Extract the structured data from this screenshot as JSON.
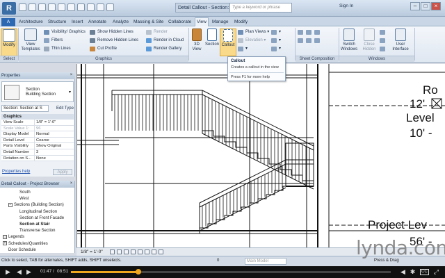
{
  "window": {
    "title": "Detail Callout - Section: Section at Stair",
    "search_placeholder": "Type a keyword or phrase",
    "sign_in": "Sign In"
  },
  "ribbon_tabs": [
    {
      "label": "A"
    },
    {
      "label": "Architecture"
    },
    {
      "label": "Structure"
    },
    {
      "label": "Insert"
    },
    {
      "label": "Annotate"
    },
    {
      "label": "Analyze"
    },
    {
      "label": "Massing & Site"
    },
    {
      "label": "Collaborate"
    },
    {
      "label": "View"
    },
    {
      "label": "Manage"
    },
    {
      "label": "Modify"
    }
  ],
  "ribbon": {
    "select_panel": "Select",
    "graphics_panel": "Graphics",
    "create_panel": "Create",
    "sheet_panel": "Sheet Composition",
    "windows_panel": "Windows",
    "modify_label": "Modify",
    "view_templates_label": "View Templates",
    "visibility_graphics": "Visibility/ Graphics",
    "filters": "Filters",
    "thin_lines": "Thin Lines",
    "show_hidden_lines": "Show Hidden Lines",
    "remove_hidden_lines": "Remove Hidden Lines",
    "cut_profile": "Cut Profile",
    "render": "Render",
    "render_in_cloud": "Render in Cloud",
    "render_gallery": "Render Gallery",
    "view_3d_label": "3D View",
    "section_label": "Section",
    "callout_label": "Callout",
    "plan_views": "Plan Views",
    "elevation": "Elevation",
    "switch_windows": "Switch Windows",
    "close_hidden": "Close Hidden",
    "user_interface": "User Interface"
  },
  "tooltip": {
    "title": "Callout",
    "description": "Creates a callout in the view",
    "help": "Press F1 for more help"
  },
  "properties": {
    "header": "Properties",
    "type_name": "Section",
    "type_sub": "Building Section",
    "instance": "Section: Section at S",
    "edit_type": "Edit Type",
    "group": "Graphics",
    "rows": [
      {
        "k": "View Scale",
        "v": "1/8\" = 1'-0\"",
        "dim": false
      },
      {
        "k": "Scale Value 1:",
        "v": "96",
        "dim": true
      },
      {
        "k": "Display Model",
        "v": "Normal",
        "dim": false
      },
      {
        "k": "Detail Level",
        "v": "Coarse",
        "dim": false
      },
      {
        "k": "Parts Visibility",
        "v": "Show Original",
        "dim": false
      },
      {
        "k": "Detail Number",
        "v": "3",
        "dim": false
      },
      {
        "k": "Rotation on S...",
        "v": "None",
        "dim": false
      }
    ],
    "help_link": "Properties help",
    "apply": "Apply"
  },
  "browser": {
    "header": "Detail Callout - Project Browser",
    "items": [
      {
        "label": "South",
        "indent": 3,
        "bold": false,
        "icon": ""
      },
      {
        "label": "West",
        "indent": 3,
        "bold": false,
        "icon": ""
      },
      {
        "label": "Sections (Building Section)",
        "indent": 1,
        "bold": false,
        "icon": "−"
      },
      {
        "label": "Longitudinal Section",
        "indent": 3,
        "bold": false,
        "icon": ""
      },
      {
        "label": "Section at Front Facade",
        "indent": 3,
        "bold": false,
        "icon": ""
      },
      {
        "label": "Section at Stair",
        "indent": 3,
        "bold": true,
        "icon": ""
      },
      {
        "label": "Transverse Section",
        "indent": 3,
        "bold": false,
        "icon": ""
      },
      {
        "label": "Legends",
        "indent": 0,
        "bold": false,
        "icon": "□"
      },
      {
        "label": "Schedules/Quantities",
        "indent": 0,
        "bold": false,
        "icon": "+"
      },
      {
        "label": "Door Schedule",
        "indent": 1,
        "bold": false,
        "icon": ""
      }
    ]
  },
  "canvas": {
    "label_ro": "Ro",
    "label_level_a1": "12'",
    "label_level_a2": "Level",
    "label_level_a3": "10' -",
    "label_project": "Project Lev",
    "label_56": "56' -"
  },
  "view_bar": {
    "scale": "1/8\" = 1'-0\""
  },
  "status": {
    "hint": "Click to select, TAB for alternates, SHIFT adds, SHIFT unselects.",
    "zero": "0",
    "model": "Main Model",
    "press_drag": "Press & Drag"
  },
  "watermark": "lynda.com",
  "player": {
    "elapsed": "01:47",
    "total": "08:51",
    "progress": 0.21,
    "cc": "CC"
  }
}
